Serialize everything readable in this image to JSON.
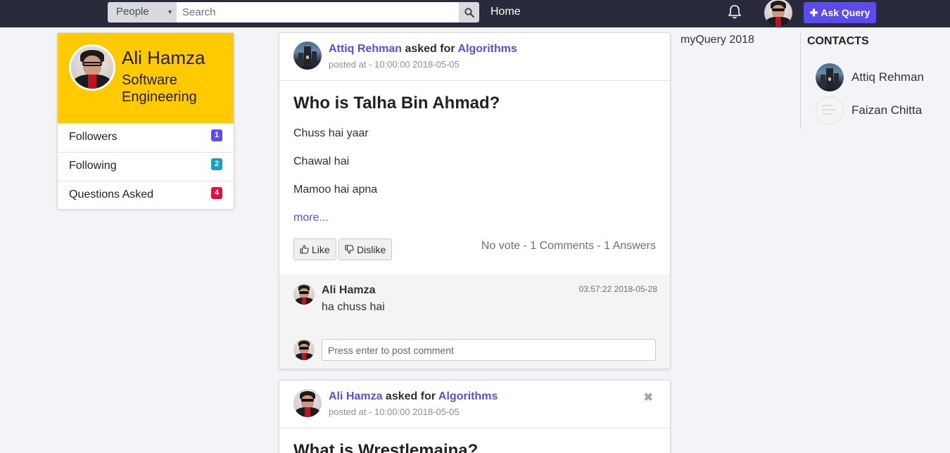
{
  "navbar": {
    "search_type": "People",
    "search_placeholder": "Search",
    "home_label": "Home",
    "ask_label": "Ask Query",
    "icons": [
      "search-icon",
      "bell-icon",
      "plus-icon"
    ]
  },
  "profile": {
    "name": "Ali Hamza",
    "role": "Software Engineering",
    "stats": [
      {
        "label": "Followers",
        "count": "1",
        "color": "#5b4cf0"
      },
      {
        "label": "Following",
        "count": "2",
        "color": "#17a2b8"
      },
      {
        "label": "Questions Asked",
        "count": "4",
        "color": "#e0113c"
      }
    ]
  },
  "posts": [
    {
      "author": "Attiq Rehman",
      "asked_for": "asked for",
      "category": "Algorithms",
      "posted": "posted at - 10:00:00 2018-05-05",
      "title": "Who is Talha Bin Ahmad?",
      "answers": [
        "Chuss hai yaar",
        "Chawal hai",
        "Mamoo hai apna"
      ],
      "more": "more...",
      "like_label": "Like",
      "dislike_label": "Dislike",
      "stats": "No vote - 1 Comments - 1 Answers",
      "comments": [
        {
          "author": "Ali Hamza",
          "time": "03:57:22 2018-05-28",
          "text": "ha chuss hai"
        }
      ],
      "comment_placeholder": "Press enter to post comment"
    },
    {
      "author": "Ali Hamza",
      "asked_for": "asked for",
      "category": "Algorithms",
      "posted": "posted at - 10:00:00 2018-05-05",
      "title": "What is Wrestlemaina?",
      "close": "✖"
    }
  ],
  "sidebar": {
    "brand": "myQuery 2018",
    "contacts_title": "CONTACTS",
    "contacts": [
      {
        "name": "Attiq Rehman"
      },
      {
        "name": "Faizan Chitta"
      }
    ]
  }
}
